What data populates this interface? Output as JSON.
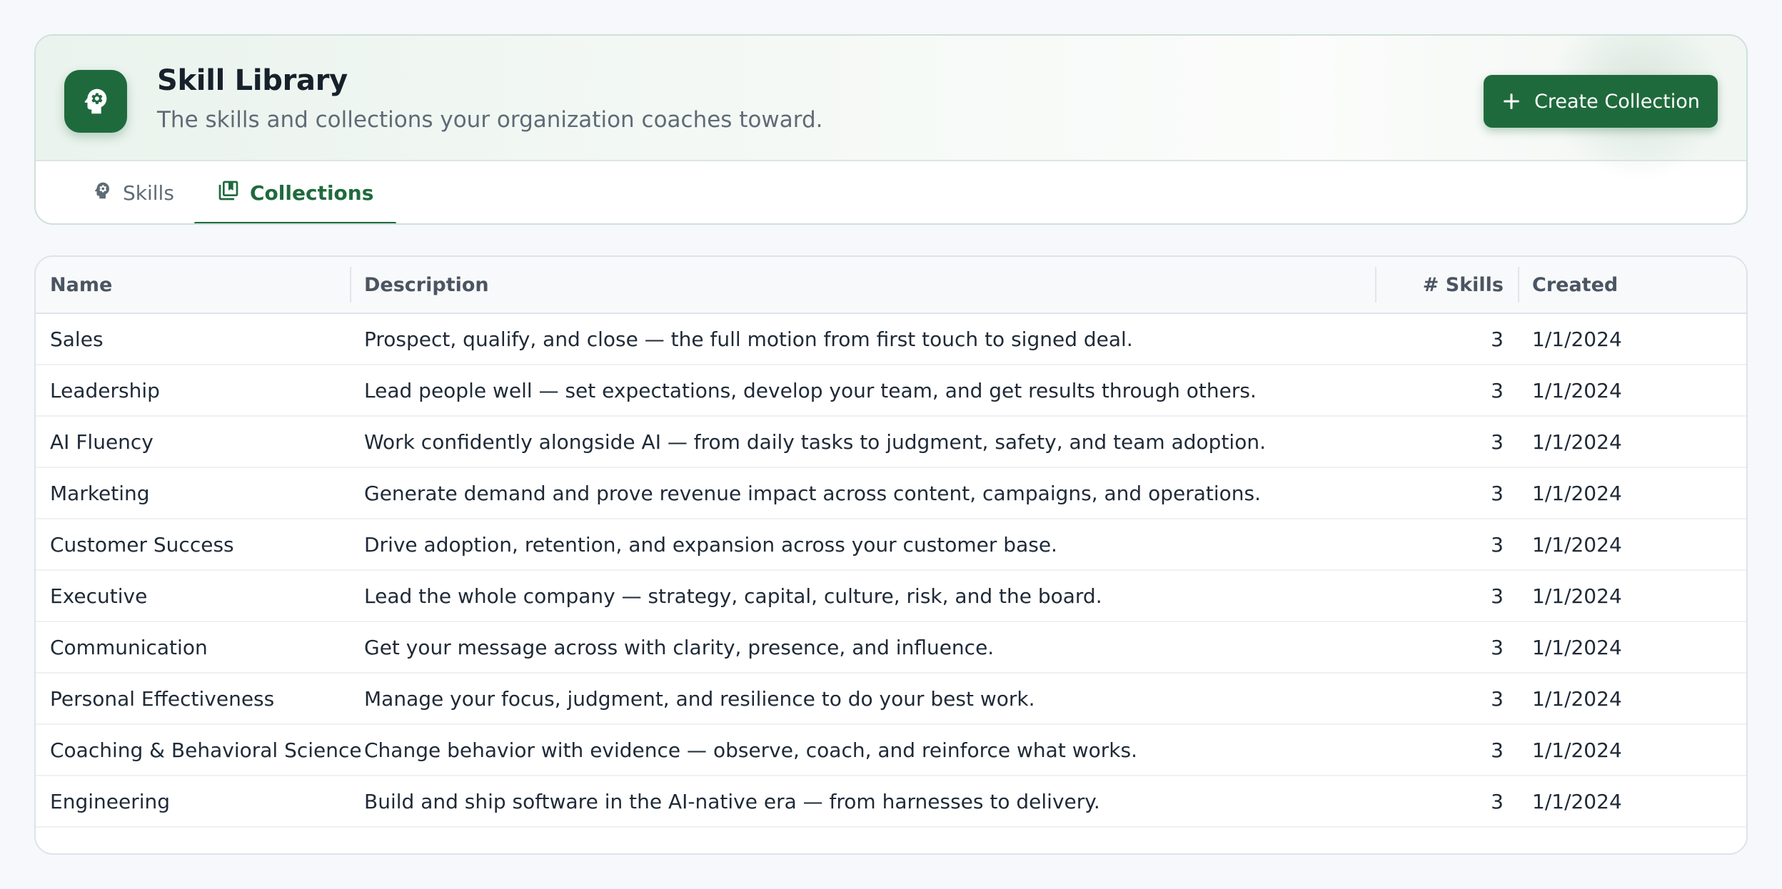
{
  "header": {
    "title": "Skill Library",
    "subtitle": "The skills and collections your organization coaches toward.",
    "app_icon": "head-gear-icon",
    "create_button": {
      "label": "Create Collection",
      "icon": "plus-icon"
    }
  },
  "tabs": [
    {
      "label": "Skills",
      "icon": "head-gear-icon",
      "active": false
    },
    {
      "label": "Collections",
      "icon": "library-books-icon",
      "active": true
    }
  ],
  "table": {
    "columns": [
      "Name",
      "Description",
      "# Skills",
      "Created"
    ],
    "rows": [
      {
        "name": "Sales",
        "description": "Prospect, qualify, and close — the full motion from first touch to signed deal.",
        "skills": "3",
        "created": "1/1/2024"
      },
      {
        "name": "Leadership",
        "description": "Lead people well — set expectations, develop your team, and get results through others.",
        "skills": "3",
        "created": "1/1/2024"
      },
      {
        "name": "AI Fluency",
        "description": "Work confidently alongside AI — from daily tasks to judgment, safety, and team adoption.",
        "skills": "3",
        "created": "1/1/2024"
      },
      {
        "name": "Marketing",
        "description": "Generate demand and prove revenue impact across content, campaigns, and operations.",
        "skills": "3",
        "created": "1/1/2024"
      },
      {
        "name": "Customer Success",
        "description": "Drive adoption, retention, and expansion across your customer base.",
        "skills": "3",
        "created": "1/1/2024"
      },
      {
        "name": "Executive",
        "description": "Lead the whole company — strategy, capital, culture, risk, and the board.",
        "skills": "3",
        "created": "1/1/2024"
      },
      {
        "name": "Communication",
        "description": "Get your message across with clarity, presence, and influence.",
        "skills": "3",
        "created": "1/1/2024"
      },
      {
        "name": "Personal Effectiveness",
        "description": "Manage your focus, judgment, and resilience to do your best work.",
        "skills": "3",
        "created": "1/1/2024"
      },
      {
        "name": "Coaching & Behavioral Science",
        "description": "Change behavior with evidence — observe, coach, and reinforce what works.",
        "skills": "3",
        "created": "1/1/2024"
      },
      {
        "name": "Engineering",
        "description": "Build and ship software in the AI-native era — from harnesses to delivery.",
        "skills": "3",
        "created": "1/1/2024"
      }
    ]
  },
  "colors": {
    "brand": "#1f6a3d",
    "background": "#f6f8fb",
    "text": "#1f2a37",
    "muted": "#5f6b76"
  }
}
